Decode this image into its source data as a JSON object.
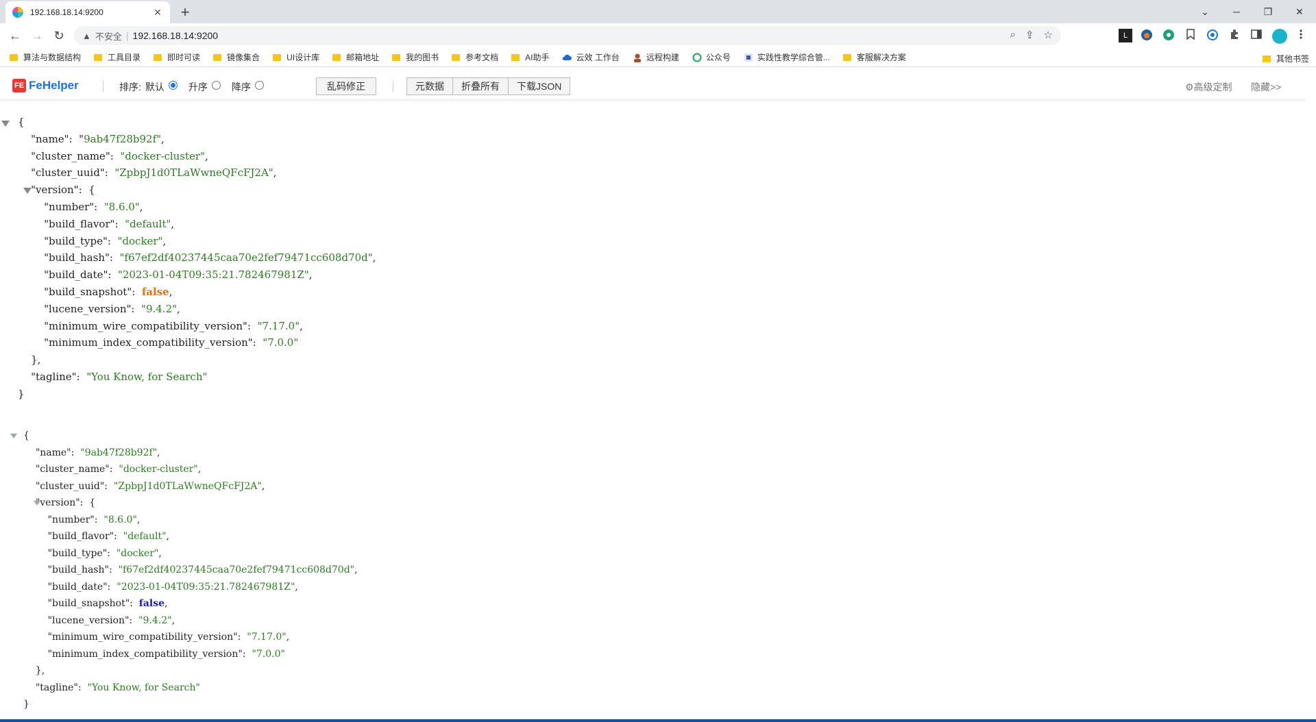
{
  "tab": {
    "title": "192.168.18.14:9200",
    "close": "✕",
    "new": "+"
  },
  "window": {
    "minimize": "─",
    "restore": "❐",
    "close": "✕",
    "menu": "⌄"
  },
  "nav": {
    "back": "←",
    "forward": "→",
    "reload": "↻"
  },
  "omnibox": {
    "warning_icon": "▲",
    "insecure": "不安全",
    "separator": "|",
    "url": "192.168.18.14:9200"
  },
  "omnibox_icons": [
    "⌕",
    "⇪",
    "☆"
  ],
  "bookmarks": [
    {
      "label": "算法与数据结构",
      "icon": "folder"
    },
    {
      "label": "工具目录",
      "icon": "folder"
    },
    {
      "label": "即时可读",
      "icon": "folder"
    },
    {
      "label": "镜像集合",
      "icon": "folder"
    },
    {
      "label": "UI设计库",
      "icon": "folder"
    },
    {
      "label": "邮箱地址",
      "icon": "folder"
    },
    {
      "label": "我的图书",
      "icon": "folder"
    },
    {
      "label": "参考文档",
      "icon": "folder"
    },
    {
      "label": "AI助手",
      "icon": "folder"
    },
    {
      "label": "云效 工作台",
      "icon": "cloud",
      "color": "#1e66d0"
    },
    {
      "label": "远程构建",
      "icon": "person",
      "color": "#a0522d"
    },
    {
      "label": "公众号",
      "icon": "wechat",
      "color": "#2aae67"
    },
    {
      "label": "实践性教学综合管...",
      "icon": "site",
      "color": "#3a5ba0"
    },
    {
      "label": "客服解决方案",
      "icon": "folder"
    }
  ],
  "bookmarks_other": "其他书签",
  "fehelper": {
    "logo_mark": "FE",
    "logo_text": "FeHelper",
    "sort_label": "排序:",
    "sort_default": "默认",
    "sort_asc": "升序",
    "sort_desc": "降序",
    "fix_encoding": "乱码修正",
    "raw": "元数据",
    "collapse_all": "折叠所有",
    "download_json": "下载JSON",
    "advanced": "⚙高级定制",
    "hide": "隐藏>>"
  },
  "json_doc": {
    "name": "9ab47f28b92f",
    "cluster_name": "docker-cluster",
    "cluster_uuid": "ZpbpJ1d0TLaWwneQFcFJ2A",
    "version": {
      "number": "8.6.0",
      "build_flavor": "default",
      "build_type": "docker",
      "build_hash": "f67ef2df40237445caa70e2fef79471cc608d70d",
      "build_date": "2023-01-04T09:35:21.782467981Z",
      "build_snapshot": "false",
      "lucene_version": "9.4.2",
      "minimum_wire_compatibility_version": "7.17.0",
      "minimum_index_compatibility_version": "7.0.0"
    },
    "tagline": "You Know, for Search"
  },
  "colors": {
    "string": "#2a7d1f",
    "bool_top": "#e0701c",
    "bool_bottom": "#1a1ab0",
    "fehelper_logo": "#1a73e8"
  }
}
